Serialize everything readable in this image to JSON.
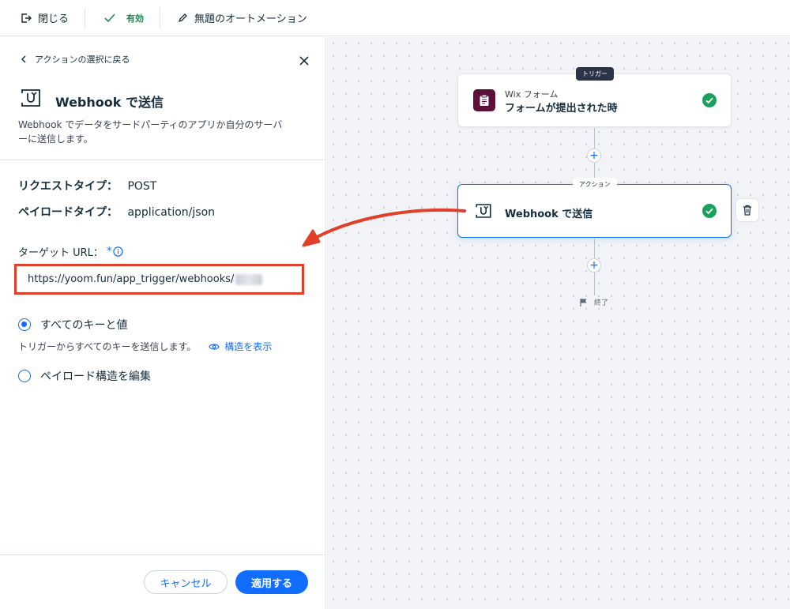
{
  "topbar": {
    "close_label": "閉じる",
    "status_label": "有効",
    "automation_title": "無題のオートメーション"
  },
  "panel": {
    "back_label": "アクションの選択に戻る",
    "title": "Webhook で送信",
    "description": "Webhook でデータをサードパーティのアプリか自分のサーバーに送信します。",
    "request_type_label": "リクエストタイプ：",
    "request_type_value": "POST",
    "payload_type_label": "ペイロードタイプ：",
    "payload_type_value": "application/json",
    "target_url_label": "ターゲット URL：",
    "target_url_required": "*",
    "target_url_value": "https://yoom.fun/app_trigger/webhooks/",
    "option_all_label": "すべてのキーと値",
    "option_all_desc": "トリガーからすべてのキーを送信します。",
    "show_structure_label": "構造を表示",
    "option_edit_label": "ペイロード構造を編集",
    "cancel_label": "キャンセル",
    "apply_label": "適用する"
  },
  "canvas": {
    "trigger_badge": "トリガー",
    "trigger_app": "Wix フォーム",
    "trigger_title": "フォームが提出された時",
    "action_badge": "アクション",
    "action_title": "Webhook で送信",
    "end_label": "終了"
  },
  "colors": {
    "accent": "#116dff",
    "success": "#1b8a4f",
    "highlight": "#e0402a",
    "wix_form_icon": "#5c0f38"
  }
}
